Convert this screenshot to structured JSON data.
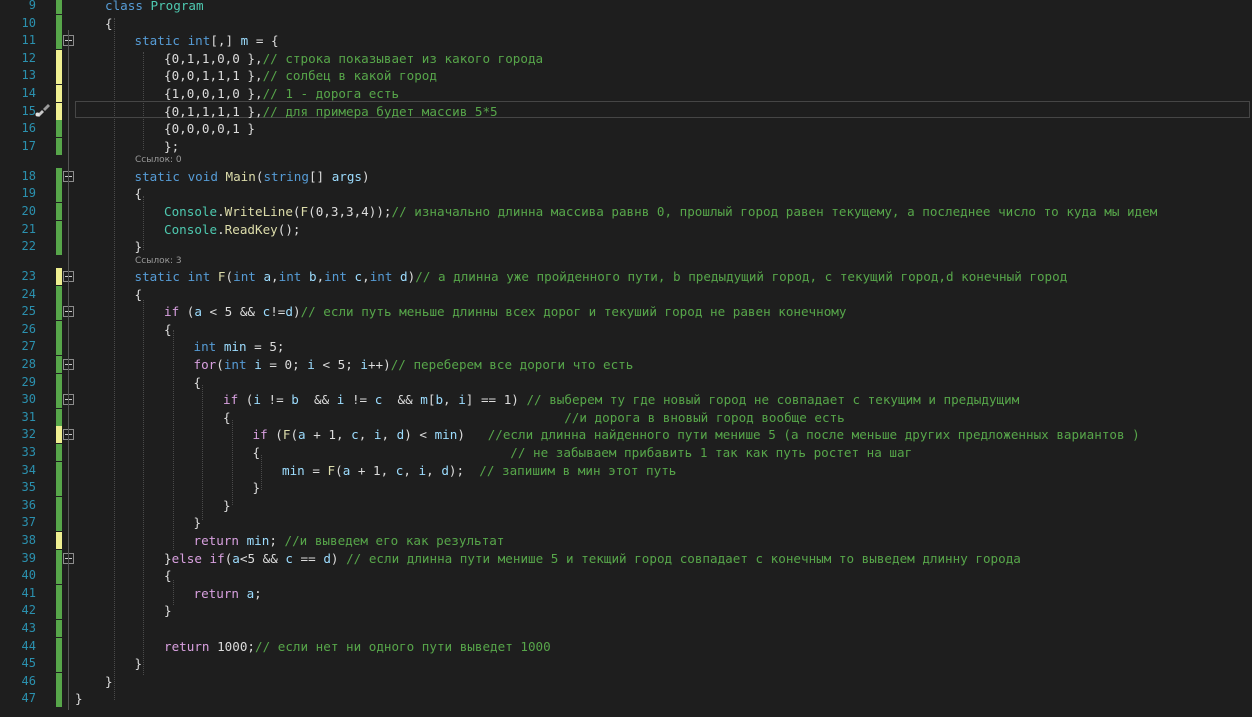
{
  "editor": {
    "lines": [
      {
        "n": "9",
        "indent": 0,
        "parts": [
          {
            "c": "kw",
            "t": "class "
          },
          {
            "c": "ty",
            "t": "Program"
          }
        ]
      },
      {
        "n": "10",
        "indent": 0,
        "parts": [
          {
            "c": "tx",
            "t": "{"
          }
        ]
      },
      {
        "n": "11",
        "indent": 1,
        "parts": [
          {
            "c": "kw",
            "t": "static "
          },
          {
            "c": "kw",
            "t": "int"
          },
          {
            "c": "tx",
            "t": "[,] "
          },
          {
            "c": "var",
            "t": "m"
          },
          {
            "c": "tx",
            "t": " = {"
          }
        ]
      },
      {
        "n": "12",
        "indent": 2,
        "parts": [
          {
            "c": "tx",
            "t": "{0,1,1,0,0 },"
          },
          {
            "c": "cm",
            "t": "// строка показывает из какого города"
          }
        ]
      },
      {
        "n": "13",
        "indent": 2,
        "parts": [
          {
            "c": "tx",
            "t": "{0,0,1,1,1 },"
          },
          {
            "c": "cm",
            "t": "// солбец в какой город"
          }
        ]
      },
      {
        "n": "14",
        "indent": 2,
        "parts": [
          {
            "c": "tx",
            "t": "{1,0,0,1,0 },"
          },
          {
            "c": "cm",
            "t": "// 1 - дорога есть"
          }
        ]
      },
      {
        "n": "15",
        "indent": 2,
        "parts": [
          {
            "c": "tx",
            "t": "{0,1,1,1,1 },"
          },
          {
            "c": "cm",
            "t": "// для примера будет массив 5*5"
          }
        ]
      },
      {
        "n": "16",
        "indent": 2,
        "parts": [
          {
            "c": "tx",
            "t": "{0,0,0,0,1 }"
          }
        ]
      },
      {
        "n": "17",
        "indent": 2,
        "parts": [
          {
            "c": "tx",
            "t": "};"
          }
        ]
      },
      {
        "n": "18",
        "indent": 1,
        "parts": [
          {
            "c": "kw",
            "t": "static "
          },
          {
            "c": "kw",
            "t": "void "
          },
          {
            "c": "fn",
            "t": "Main"
          },
          {
            "c": "tx",
            "t": "("
          },
          {
            "c": "kw",
            "t": "string"
          },
          {
            "c": "tx",
            "t": "[] "
          },
          {
            "c": "var",
            "t": "args"
          },
          {
            "c": "tx",
            "t": ")"
          }
        ]
      },
      {
        "n": "19",
        "indent": 1,
        "parts": [
          {
            "c": "tx",
            "t": "{"
          }
        ]
      },
      {
        "n": "20",
        "indent": 2,
        "parts": [
          {
            "c": "ty",
            "t": "Console"
          },
          {
            "c": "tx",
            "t": "."
          },
          {
            "c": "fn",
            "t": "WriteLine"
          },
          {
            "c": "tx",
            "t": "("
          },
          {
            "c": "fn",
            "t": "F"
          },
          {
            "c": "tx",
            "t": "(0,3,3,4));"
          },
          {
            "c": "cm",
            "t": "// изначально длинна массива равнв 0, прошлый город равен текущему, а последнее число то куда мы идем"
          }
        ]
      },
      {
        "n": "21",
        "indent": 2,
        "parts": [
          {
            "c": "ty",
            "t": "Console"
          },
          {
            "c": "tx",
            "t": "."
          },
          {
            "c": "fn",
            "t": "ReadKey"
          },
          {
            "c": "tx",
            "t": "();"
          }
        ]
      },
      {
        "n": "22",
        "indent": 1,
        "parts": [
          {
            "c": "tx",
            "t": "}"
          }
        ]
      },
      {
        "n": "23",
        "indent": 1,
        "parts": [
          {
            "c": "kw",
            "t": "static "
          },
          {
            "c": "kw",
            "t": "int "
          },
          {
            "c": "fn",
            "t": "F"
          },
          {
            "c": "tx",
            "t": "("
          },
          {
            "c": "kw",
            "t": "int "
          },
          {
            "c": "var",
            "t": "a"
          },
          {
            "c": "tx",
            "t": ","
          },
          {
            "c": "kw",
            "t": "int "
          },
          {
            "c": "var",
            "t": "b"
          },
          {
            "c": "tx",
            "t": ","
          },
          {
            "c": "kw",
            "t": "int "
          },
          {
            "c": "var",
            "t": "c"
          },
          {
            "c": "tx",
            "t": ","
          },
          {
            "c": "kw",
            "t": "int "
          },
          {
            "c": "var",
            "t": "d"
          },
          {
            "c": "tx",
            "t": ")"
          },
          {
            "c": "cm",
            "t": "// а длинна уже пройденного пути, b предыдущий город, c текущий город,d конечный город"
          }
        ]
      },
      {
        "n": "24",
        "indent": 1,
        "parts": [
          {
            "c": "tx",
            "t": "{"
          }
        ]
      },
      {
        "n": "25",
        "indent": 2,
        "parts": [
          {
            "c": "pr",
            "t": "if "
          },
          {
            "c": "tx",
            "t": "("
          },
          {
            "c": "var",
            "t": "a"
          },
          {
            "c": "tx",
            "t": " < 5 && "
          },
          {
            "c": "var",
            "t": "c"
          },
          {
            "c": "tx",
            "t": "!="
          },
          {
            "c": "var",
            "t": "d"
          },
          {
            "c": "tx",
            "t": ")"
          },
          {
            "c": "cm",
            "t": "// если путь меньше длинны всех дорог и текуший город не равен конечному"
          }
        ]
      },
      {
        "n": "26",
        "indent": 2,
        "parts": [
          {
            "c": "tx",
            "t": "{"
          }
        ]
      },
      {
        "n": "27",
        "indent": 3,
        "parts": [
          {
            "c": "kw",
            "t": "int "
          },
          {
            "c": "var",
            "t": "min"
          },
          {
            "c": "tx",
            "t": " = 5;"
          }
        ]
      },
      {
        "n": "28",
        "indent": 3,
        "parts": [
          {
            "c": "pr",
            "t": "for"
          },
          {
            "c": "tx",
            "t": "("
          },
          {
            "c": "kw",
            "t": "int "
          },
          {
            "c": "var",
            "t": "i"
          },
          {
            "c": "tx",
            "t": " = 0; "
          },
          {
            "c": "var",
            "t": "i"
          },
          {
            "c": "tx",
            "t": " < 5; "
          },
          {
            "c": "var",
            "t": "i"
          },
          {
            "c": "tx",
            "t": "++)"
          },
          {
            "c": "cm",
            "t": "// переберем все дороги что есть"
          }
        ]
      },
      {
        "n": "29",
        "indent": 3,
        "parts": [
          {
            "c": "tx",
            "t": "{"
          }
        ]
      },
      {
        "n": "30",
        "indent": 4,
        "parts": [
          {
            "c": "pr",
            "t": "if "
          },
          {
            "c": "tx",
            "t": "("
          },
          {
            "c": "var",
            "t": "i"
          },
          {
            "c": "tx",
            "t": " != "
          },
          {
            "c": "var",
            "t": "b"
          },
          {
            "c": "tx",
            "t": "  && "
          },
          {
            "c": "var",
            "t": "i"
          },
          {
            "c": "tx",
            "t": " != "
          },
          {
            "c": "var",
            "t": "c"
          },
          {
            "c": "tx",
            "t": "  && "
          },
          {
            "c": "var",
            "t": "m"
          },
          {
            "c": "tx",
            "t": "["
          },
          {
            "c": "var",
            "t": "b"
          },
          {
            "c": "tx",
            "t": ", "
          },
          {
            "c": "var",
            "t": "i"
          },
          {
            "c": "tx",
            "t": "] == 1) "
          },
          {
            "c": "cm",
            "t": "// выберем ту где новый город не совпадает с текущим и предыдущим"
          }
        ]
      },
      {
        "n": "31",
        "indent": 4,
        "parts": [
          {
            "c": "tx",
            "t": "{                                            "
          },
          {
            "c": "cm",
            "t": "//и дорога в вновый город вообще есть"
          }
        ]
      },
      {
        "n": "32",
        "indent": 5,
        "parts": [
          {
            "c": "pr",
            "t": "if "
          },
          {
            "c": "tx",
            "t": "("
          },
          {
            "c": "fn",
            "t": "F"
          },
          {
            "c": "tx",
            "t": "("
          },
          {
            "c": "var",
            "t": "a"
          },
          {
            "c": "tx",
            "t": " + 1, "
          },
          {
            "c": "var",
            "t": "c"
          },
          {
            "c": "tx",
            "t": ", "
          },
          {
            "c": "var",
            "t": "i"
          },
          {
            "c": "tx",
            "t": ", "
          },
          {
            "c": "var",
            "t": "d"
          },
          {
            "c": "tx",
            "t": ") < "
          },
          {
            "c": "var",
            "t": "min"
          },
          {
            "c": "tx",
            "t": ")   "
          },
          {
            "c": "cm",
            "t": "//если длинна найденного пути менише 5 (а после меньше других предложенных вариантов )"
          }
        ]
      },
      {
        "n": "33",
        "indent": 5,
        "parts": [
          {
            "c": "tx",
            "t": "{                                 "
          },
          {
            "c": "cm",
            "t": "// не забываем прибавить 1 так как путь ростет на шаг"
          }
        ]
      },
      {
        "n": "34",
        "indent": 6,
        "parts": [
          {
            "c": "var",
            "t": "min"
          },
          {
            "c": "tx",
            "t": " = "
          },
          {
            "c": "fn",
            "t": "F"
          },
          {
            "c": "tx",
            "t": "("
          },
          {
            "c": "var",
            "t": "a"
          },
          {
            "c": "tx",
            "t": " + 1, "
          },
          {
            "c": "var",
            "t": "c"
          },
          {
            "c": "tx",
            "t": ", "
          },
          {
            "c": "var",
            "t": "i"
          },
          {
            "c": "tx",
            "t": ", "
          },
          {
            "c": "var",
            "t": "d"
          },
          {
            "c": "tx",
            "t": ");  "
          },
          {
            "c": "cm",
            "t": "// запишим в мин этот путь"
          }
        ]
      },
      {
        "n": "35",
        "indent": 5,
        "parts": [
          {
            "c": "tx",
            "t": "}"
          }
        ]
      },
      {
        "n": "36",
        "indent": 4,
        "parts": [
          {
            "c": "tx",
            "t": "}"
          }
        ]
      },
      {
        "n": "37",
        "indent": 3,
        "parts": [
          {
            "c": "tx",
            "t": "}"
          }
        ]
      },
      {
        "n": "38",
        "indent": 3,
        "parts": [
          {
            "c": "pr",
            "t": "return "
          },
          {
            "c": "var",
            "t": "min"
          },
          {
            "c": "tx",
            "t": "; "
          },
          {
            "c": "cm",
            "t": "//и выведем его как результат"
          }
        ]
      },
      {
        "n": "39",
        "indent": 2,
        "parts": [
          {
            "c": "tx",
            "t": "}"
          },
          {
            "c": "pr",
            "t": "else "
          },
          {
            "c": "pr",
            "t": "if"
          },
          {
            "c": "tx",
            "t": "("
          },
          {
            "c": "var",
            "t": "a"
          },
          {
            "c": "tx",
            "t": "<5 && "
          },
          {
            "c": "var",
            "t": "c"
          },
          {
            "c": "tx",
            "t": " == "
          },
          {
            "c": "var",
            "t": "d"
          },
          {
            "c": "tx",
            "t": ") "
          },
          {
            "c": "cm",
            "t": "// если длинна пути менише 5 и текщий город совпадает с конечным то выведем длинну города"
          }
        ]
      },
      {
        "n": "40",
        "indent": 2,
        "parts": [
          {
            "c": "tx",
            "t": "{"
          }
        ]
      },
      {
        "n": "41",
        "indent": 3,
        "parts": [
          {
            "c": "pr",
            "t": "return "
          },
          {
            "c": "var",
            "t": "a"
          },
          {
            "c": "tx",
            "t": ";"
          }
        ]
      },
      {
        "n": "42",
        "indent": 2,
        "parts": [
          {
            "c": "tx",
            "t": "}"
          }
        ]
      },
      {
        "n": "43",
        "indent": 2,
        "parts": []
      },
      {
        "n": "44",
        "indent": 2,
        "parts": [
          {
            "c": "pr",
            "t": "return "
          },
          {
            "c": "tx",
            "t": "1000;"
          },
          {
            "c": "cm",
            "t": "// если нет ни одного пути выведет 1000"
          }
        ]
      },
      {
        "n": "45",
        "indent": 1,
        "parts": [
          {
            "c": "tx",
            "t": "}"
          }
        ]
      },
      {
        "n": "46",
        "indent": 0,
        "parts": [
          {
            "c": "tx",
            "t": "}"
          }
        ]
      },
      {
        "n": "47",
        "indent": -1,
        "parts": [
          {
            "c": "tx",
            "t": "}"
          }
        ]
      }
    ],
    "codelens": [
      {
        "after": "17",
        "text": "Ссылок: 0"
      },
      {
        "after": "22",
        "text": "Ссылок: 3"
      }
    ],
    "yellow_lines": [
      "12",
      "13",
      "14",
      "15",
      "23",
      "32",
      "38"
    ],
    "fold_lines": [
      "11",
      "18",
      "23",
      "25",
      "28",
      "30",
      "32",
      "39"
    ],
    "colors": {
      "background": "#1e1e1e",
      "line_number": "#2b91af",
      "keyword": "#569cd6",
      "control_keyword": "#d8a0df",
      "comment": "#57a64a",
      "type": "#4ec9b0",
      "method": "#dcdcaa",
      "variable": "#9cdcfe"
    },
    "gutter_icon": "paintbrush-icon"
  }
}
